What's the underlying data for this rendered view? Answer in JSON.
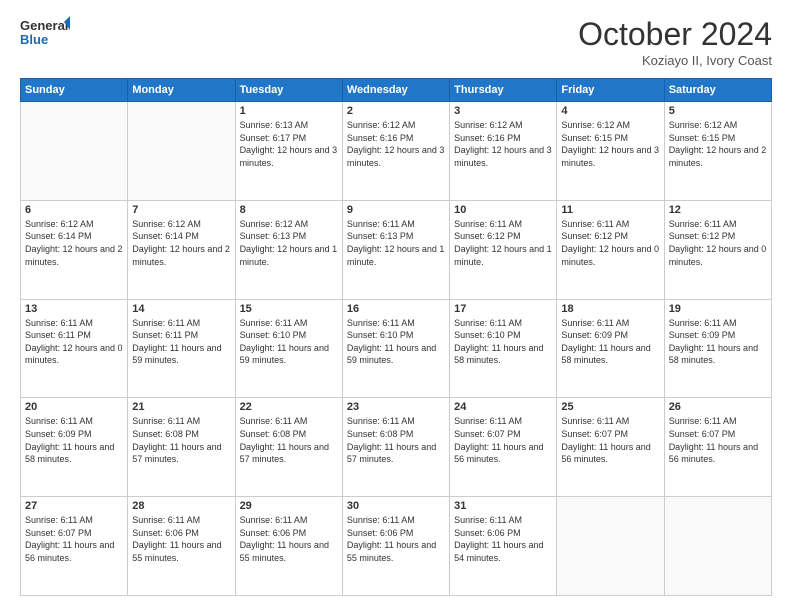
{
  "header": {
    "logo_line1": "General",
    "logo_line2": "Blue",
    "month_title": "October 2024",
    "location": "Koziayo II, Ivory Coast"
  },
  "days_of_week": [
    "Sunday",
    "Monday",
    "Tuesday",
    "Wednesday",
    "Thursday",
    "Friday",
    "Saturday"
  ],
  "weeks": [
    [
      {
        "day": "",
        "info": ""
      },
      {
        "day": "",
        "info": ""
      },
      {
        "day": "1",
        "info": "Sunrise: 6:13 AM\nSunset: 6:17 PM\nDaylight: 12 hours and 3 minutes."
      },
      {
        "day": "2",
        "info": "Sunrise: 6:12 AM\nSunset: 6:16 PM\nDaylight: 12 hours and 3 minutes."
      },
      {
        "day": "3",
        "info": "Sunrise: 6:12 AM\nSunset: 6:16 PM\nDaylight: 12 hours and 3 minutes."
      },
      {
        "day": "4",
        "info": "Sunrise: 6:12 AM\nSunset: 6:15 PM\nDaylight: 12 hours and 3 minutes."
      },
      {
        "day": "5",
        "info": "Sunrise: 6:12 AM\nSunset: 6:15 PM\nDaylight: 12 hours and 2 minutes."
      }
    ],
    [
      {
        "day": "6",
        "info": "Sunrise: 6:12 AM\nSunset: 6:14 PM\nDaylight: 12 hours and 2 minutes."
      },
      {
        "day": "7",
        "info": "Sunrise: 6:12 AM\nSunset: 6:14 PM\nDaylight: 12 hours and 2 minutes."
      },
      {
        "day": "8",
        "info": "Sunrise: 6:12 AM\nSunset: 6:13 PM\nDaylight: 12 hours and 1 minute."
      },
      {
        "day": "9",
        "info": "Sunrise: 6:11 AM\nSunset: 6:13 PM\nDaylight: 12 hours and 1 minute."
      },
      {
        "day": "10",
        "info": "Sunrise: 6:11 AM\nSunset: 6:12 PM\nDaylight: 12 hours and 1 minute."
      },
      {
        "day": "11",
        "info": "Sunrise: 6:11 AM\nSunset: 6:12 PM\nDaylight: 12 hours and 0 minutes."
      },
      {
        "day": "12",
        "info": "Sunrise: 6:11 AM\nSunset: 6:12 PM\nDaylight: 12 hours and 0 minutes."
      }
    ],
    [
      {
        "day": "13",
        "info": "Sunrise: 6:11 AM\nSunset: 6:11 PM\nDaylight: 12 hours and 0 minutes."
      },
      {
        "day": "14",
        "info": "Sunrise: 6:11 AM\nSunset: 6:11 PM\nDaylight: 11 hours and 59 minutes."
      },
      {
        "day": "15",
        "info": "Sunrise: 6:11 AM\nSunset: 6:10 PM\nDaylight: 11 hours and 59 minutes."
      },
      {
        "day": "16",
        "info": "Sunrise: 6:11 AM\nSunset: 6:10 PM\nDaylight: 11 hours and 59 minutes."
      },
      {
        "day": "17",
        "info": "Sunrise: 6:11 AM\nSunset: 6:10 PM\nDaylight: 11 hours and 58 minutes."
      },
      {
        "day": "18",
        "info": "Sunrise: 6:11 AM\nSunset: 6:09 PM\nDaylight: 11 hours and 58 minutes."
      },
      {
        "day": "19",
        "info": "Sunrise: 6:11 AM\nSunset: 6:09 PM\nDaylight: 11 hours and 58 minutes."
      }
    ],
    [
      {
        "day": "20",
        "info": "Sunrise: 6:11 AM\nSunset: 6:09 PM\nDaylight: 11 hours and 58 minutes."
      },
      {
        "day": "21",
        "info": "Sunrise: 6:11 AM\nSunset: 6:08 PM\nDaylight: 11 hours and 57 minutes."
      },
      {
        "day": "22",
        "info": "Sunrise: 6:11 AM\nSunset: 6:08 PM\nDaylight: 11 hours and 57 minutes."
      },
      {
        "day": "23",
        "info": "Sunrise: 6:11 AM\nSunset: 6:08 PM\nDaylight: 11 hours and 57 minutes."
      },
      {
        "day": "24",
        "info": "Sunrise: 6:11 AM\nSunset: 6:07 PM\nDaylight: 11 hours and 56 minutes."
      },
      {
        "day": "25",
        "info": "Sunrise: 6:11 AM\nSunset: 6:07 PM\nDaylight: 11 hours and 56 minutes."
      },
      {
        "day": "26",
        "info": "Sunrise: 6:11 AM\nSunset: 6:07 PM\nDaylight: 11 hours and 56 minutes."
      }
    ],
    [
      {
        "day": "27",
        "info": "Sunrise: 6:11 AM\nSunset: 6:07 PM\nDaylight: 11 hours and 56 minutes."
      },
      {
        "day": "28",
        "info": "Sunrise: 6:11 AM\nSunset: 6:06 PM\nDaylight: 11 hours and 55 minutes."
      },
      {
        "day": "29",
        "info": "Sunrise: 6:11 AM\nSunset: 6:06 PM\nDaylight: 11 hours and 55 minutes."
      },
      {
        "day": "30",
        "info": "Sunrise: 6:11 AM\nSunset: 6:06 PM\nDaylight: 11 hours and 55 minutes."
      },
      {
        "day": "31",
        "info": "Sunrise: 6:11 AM\nSunset: 6:06 PM\nDaylight: 11 hours and 54 minutes."
      },
      {
        "day": "",
        "info": ""
      },
      {
        "day": "",
        "info": ""
      }
    ]
  ]
}
